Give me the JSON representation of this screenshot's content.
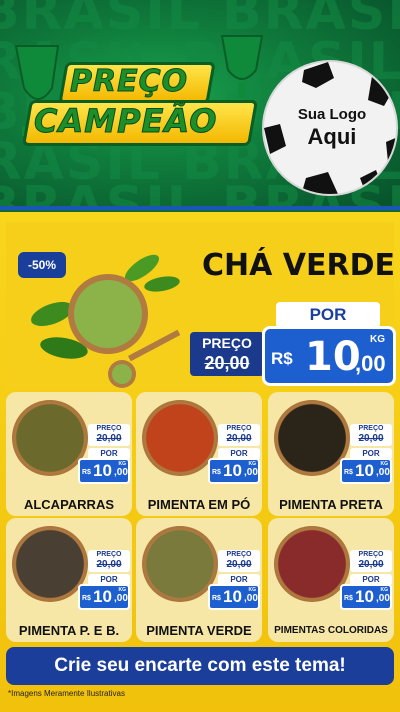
{
  "header": {
    "background_word": "BRASIL",
    "title_line1": "PREÇO",
    "title_line2": "CAMPEÃO",
    "logo_line1": "Sua Logo",
    "logo_line2": "Aqui"
  },
  "hero": {
    "discount": "-50%",
    "title": "CHÁ VERDE",
    "por_label": "POR",
    "old_label": "PREÇO",
    "old_price": "20,00",
    "currency": "R$",
    "price_int": "10",
    "price_dec": ",00",
    "unit": "KG"
  },
  "products": [
    {
      "name": "ALCAPARRAS",
      "old_label": "PREÇO",
      "old_price": "20,00",
      "por": "POR",
      "currency": "R$",
      "price_int": "10",
      "price_dec": ",00",
      "unit": "KG",
      "color": "#6b6a2c"
    },
    {
      "name": "PIMENTA EM PÓ",
      "old_label": "PREÇO",
      "old_price": "20,00",
      "por": "POR",
      "currency": "R$",
      "price_int": "10",
      "price_dec": ",00",
      "unit": "KG",
      "color": "#c1431c"
    },
    {
      "name": "PIMENTA PRETA",
      "old_label": "PREÇO",
      "old_price": "20,00",
      "por": "POR",
      "currency": "R$",
      "price_int": "10",
      "price_dec": ",00",
      "unit": "KG",
      "color": "#2a2419"
    },
    {
      "name": "PIMENTA P. E B.",
      "old_label": "PREÇO",
      "old_price": "20,00",
      "por": "POR",
      "currency": "R$",
      "price_int": "10",
      "price_dec": ",00",
      "unit": "KG",
      "color": "#4a3f33"
    },
    {
      "name": "PIMENTA VERDE",
      "old_label": "PREÇO",
      "old_price": "20,00",
      "por": "POR",
      "currency": "R$",
      "price_int": "10",
      "price_dec": ",00",
      "unit": "KG",
      "color": "#7b7a3d"
    },
    {
      "name": "PIMENTAS COLORIDAS",
      "old_label": "PREÇO",
      "old_price": "20,00",
      "por": "POR",
      "currency": "R$",
      "price_int": "10",
      "price_dec": ",00",
      "unit": "KG",
      "color": "#8a2b2b"
    }
  ],
  "footer": {
    "cta": "Crie seu encarte com este tema!",
    "disclaimer": "*Imagens Meramente Ilustrativas"
  },
  "colors": {
    "green": "#0f7a3b",
    "yellow": "#f5cf1a",
    "blue": "#1e5fd0",
    "navy": "#1b3e9a"
  }
}
